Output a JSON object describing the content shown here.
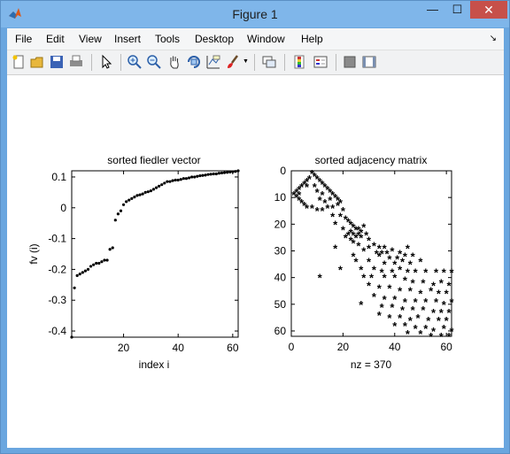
{
  "window": {
    "title": "Figure 1",
    "close_glyph": "✕",
    "minimize_glyph": "—",
    "maximize_glyph": "☐"
  },
  "menu": [
    "File",
    "Edit",
    "View",
    "Insert",
    "Tools",
    "Desktop",
    "Window",
    "Help"
  ],
  "toolbar_icons": [
    "new-figure-icon",
    "open-file-icon",
    "save-icon",
    "print-icon",
    "pointer-icon",
    "zoom-in-icon",
    "zoom-out-icon",
    "pan-icon",
    "rotate-3d-icon",
    "data-cursor-icon",
    "brush-icon",
    "brush-dropdown-icon",
    "link-plot-icon",
    "colorbar-icon",
    "legend-icon",
    "hide-plot-tools-icon",
    "show-plot-tools-icon"
  ],
  "chart_data": [
    {
      "type": "scatter",
      "title": "sorted fiedler vector",
      "xlabel": "index i",
      "ylabel": "fv (i)",
      "xlim": [
        1,
        62
      ],
      "ylim": [
        -0.42,
        0.12
      ],
      "xticks": [
        20,
        40,
        60
      ],
      "yticks": [
        0.1,
        0,
        -0.1,
        -0.2,
        -0.3,
        -0.4
      ],
      "ytick_labels": [
        "0.1",
        "0",
        "-0.1",
        "-0.2",
        "-0.3",
        "-0.4"
      ],
      "marker": "point",
      "color": "#000000",
      "x": [
        1,
        2,
        3,
        4,
        5,
        6,
        7,
        8,
        9,
        10,
        11,
        12,
        13,
        14,
        15,
        16,
        17,
        18,
        19,
        20,
        21,
        22,
        23,
        24,
        25,
        26,
        27,
        28,
        29,
        30,
        31,
        32,
        33,
        34,
        35,
        36,
        37,
        38,
        39,
        40,
        41,
        42,
        43,
        44,
        45,
        46,
        47,
        48,
        49,
        50,
        51,
        52,
        53,
        54,
        55,
        56,
        57,
        58,
        59,
        60,
        61,
        62
      ],
      "y": [
        -0.42,
        -0.26,
        -0.22,
        -0.215,
        -0.21,
        -0.205,
        -0.2,
        -0.19,
        -0.185,
        -0.18,
        -0.18,
        -0.175,
        -0.17,
        -0.17,
        -0.135,
        -0.13,
        -0.04,
        -0.02,
        -0.01,
        0.01,
        0.02,
        0.025,
        0.03,
        0.035,
        0.04,
        0.042,
        0.045,
        0.05,
        0.052,
        0.055,
        0.06,
        0.065,
        0.07,
        0.075,
        0.08,
        0.085,
        0.085,
        0.088,
        0.09,
        0.09,
        0.092,
        0.095,
        0.095,
        0.097,
        0.1,
        0.1,
        0.102,
        0.104,
        0.105,
        0.106,
        0.108,
        0.109,
        0.11,
        0.11,
        0.112,
        0.113,
        0.114,
        0.115,
        0.116,
        0.117,
        0.118,
        0.12
      ]
    },
    {
      "type": "scatter",
      "title": "sorted adjacency matrix",
      "xlabel": "nz = 370",
      "ylabel": "",
      "xlim": [
        0,
        62
      ],
      "ylim": [
        0,
        62
      ],
      "y_reversed": true,
      "xticks": [
        0,
        20,
        40,
        60
      ],
      "yticks": [
        0,
        10,
        20,
        30,
        40,
        50,
        60
      ],
      "marker": "asterisk",
      "color": "#000000",
      "nz": 370,
      "points": [
        [
          8,
          1
        ],
        [
          9,
          2
        ],
        [
          7,
          3
        ],
        [
          10,
          3
        ],
        [
          6,
          4
        ],
        [
          11,
          4
        ],
        [
          5,
          5
        ],
        [
          12,
          5
        ],
        [
          4,
          6
        ],
        [
          13,
          6
        ],
        [
          6,
          6
        ],
        [
          3,
          7
        ],
        [
          14,
          7
        ],
        [
          2,
          8
        ],
        [
          1,
          9
        ],
        [
          3,
          9
        ],
        [
          15,
          8
        ],
        [
          2,
          10
        ],
        [
          16,
          9
        ],
        [
          3,
          11
        ],
        [
          17,
          10
        ],
        [
          4,
          12
        ],
        [
          18,
          11
        ],
        [
          5,
          13
        ],
        [
          19,
          12
        ],
        [
          6,
          14
        ],
        [
          8,
          14
        ],
        [
          10,
          15
        ],
        [
          12,
          15
        ],
        [
          14,
          14
        ],
        [
          16,
          14
        ],
        [
          9,
          6
        ],
        [
          10,
          8
        ],
        [
          12,
          9
        ],
        [
          11,
          11
        ],
        [
          13,
          12
        ],
        [
          15,
          11
        ],
        [
          18,
          13
        ],
        [
          20,
          15
        ],
        [
          16,
          17
        ],
        [
          19,
          17
        ],
        [
          21,
          18
        ],
        [
          22,
          19
        ],
        [
          17,
          20
        ],
        [
          23,
          20
        ],
        [
          24,
          21
        ],
        [
          25,
          22
        ],
        [
          20,
          22
        ],
        [
          26,
          22
        ],
        [
          23,
          23
        ],
        [
          27,
          23
        ],
        [
          22,
          24
        ],
        [
          24,
          24
        ],
        [
          26,
          24
        ],
        [
          21,
          25
        ],
        [
          25,
          25
        ],
        [
          27,
          25
        ],
        [
          23,
          26
        ],
        [
          28,
          21
        ],
        [
          29,
          24
        ],
        [
          30,
          26
        ],
        [
          24,
          27
        ],
        [
          26,
          28
        ],
        [
          17,
          29
        ],
        [
          30,
          29
        ],
        [
          32,
          28
        ],
        [
          34,
          29
        ],
        [
          36,
          29
        ],
        [
          28,
          30
        ],
        [
          33,
          31
        ],
        [
          35,
          31
        ],
        [
          37,
          31
        ],
        [
          39,
          30
        ],
        [
          42,
          31
        ],
        [
          45,
          29
        ],
        [
          24,
          32
        ],
        [
          34,
          32
        ],
        [
          38,
          33
        ],
        [
          41,
          33
        ],
        [
          44,
          32
        ],
        [
          47,
          32
        ],
        [
          25,
          34
        ],
        [
          30,
          34
        ],
        [
          36,
          35
        ],
        [
          40,
          35
        ],
        [
          43,
          34
        ],
        [
          46,
          35
        ],
        [
          50,
          34
        ],
        [
          19,
          37
        ],
        [
          27,
          37
        ],
        [
          32,
          37
        ],
        [
          35,
          38
        ],
        [
          39,
          38
        ],
        [
          42,
          37
        ],
        [
          45,
          38
        ],
        [
          48,
          38
        ],
        [
          52,
          38
        ],
        [
          56,
          38
        ],
        [
          59,
          38
        ],
        [
          62,
          38
        ],
        [
          11,
          40
        ],
        [
          28,
          40
        ],
        [
          31,
          40
        ],
        [
          36,
          40
        ],
        [
          40,
          40
        ],
        [
          44,
          41
        ],
        [
          47,
          42
        ],
        [
          51,
          42
        ],
        [
          55,
          43
        ],
        [
          58,
          42
        ],
        [
          61,
          43
        ],
        [
          30,
          43
        ],
        [
          34,
          44
        ],
        [
          38,
          44
        ],
        [
          42,
          45
        ],
        [
          46,
          45
        ],
        [
          50,
          46
        ],
        [
          54,
          45
        ],
        [
          57,
          46
        ],
        [
          60,
          46
        ],
        [
          32,
          47
        ],
        [
          36,
          48
        ],
        [
          40,
          48
        ],
        [
          44,
          49
        ],
        [
          48,
          49
        ],
        [
          52,
          49
        ],
        [
          56,
          49
        ],
        [
          59,
          50
        ],
        [
          62,
          49
        ],
        [
          27,
          50
        ],
        [
          35,
          51
        ],
        [
          39,
          51
        ],
        [
          43,
          52
        ],
        [
          47,
          52
        ],
        [
          51,
          52
        ],
        [
          55,
          53
        ],
        [
          58,
          53
        ],
        [
          61,
          53
        ],
        [
          34,
          54
        ],
        [
          38,
          55
        ],
        [
          42,
          55
        ],
        [
          46,
          56
        ],
        [
          49,
          55
        ],
        [
          53,
          56
        ],
        [
          57,
          56
        ],
        [
          60,
          56
        ],
        [
          40,
          58
        ],
        [
          44,
          58
        ],
        [
          48,
          59
        ],
        [
          52,
          59
        ],
        [
          55,
          60
        ],
        [
          59,
          59
        ],
        [
          62,
          60
        ],
        [
          45,
          61
        ],
        [
          50,
          61
        ],
        [
          54,
          62
        ],
        [
          58,
          62
        ],
        [
          61,
          62
        ]
      ]
    }
  ]
}
